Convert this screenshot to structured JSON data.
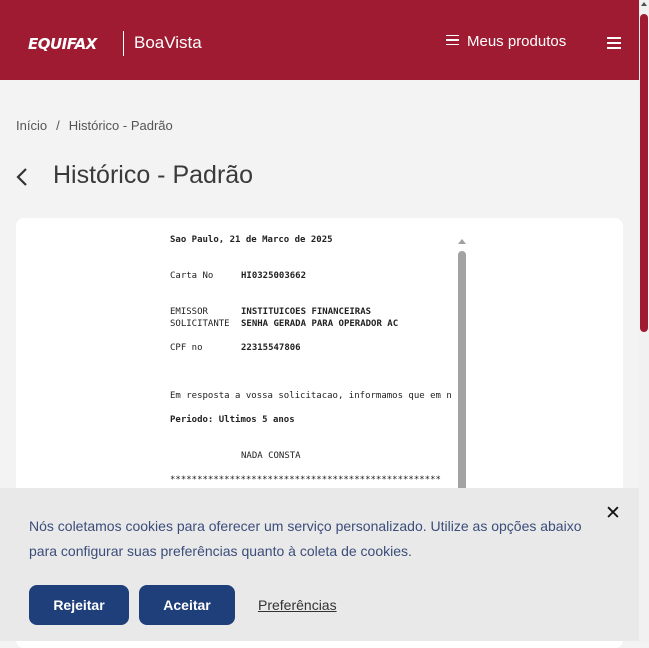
{
  "header": {
    "logo_left": "EQUIFAX",
    "logo_right": "BoaVista",
    "products_label": "Meus produtos"
  },
  "breadcrumb": {
    "home": "Início",
    "separator": "/",
    "current": "Histórico - Padrão"
  },
  "page_title": "Histórico - Padrão",
  "document": {
    "date_line": "Sao Paulo, 21 de Marco de 2025",
    "carta_label": "Carta No",
    "carta_value": "HI0325003662",
    "emissor_label": "EMISSOR",
    "emissor_value": "INSTITUICOES FINANCEIRAS",
    "solicitante_label": "SOLICITANTE",
    "solicitante_value": "SENHA GERADA PARA OPERADOR AC",
    "cpf_label": "CPF no",
    "cpf_value": "22315547806",
    "response_line": "Em resposta a vossa solicitacao, informamos que em n",
    "periodo_line": "Periodo: Ultimos 5 anos",
    "status": "NADA CONSTA",
    "divider": "**************************************************"
  },
  "cookie": {
    "text": "Nós coletamos cookies para oferecer um serviço personalizado. Utilize as opções abaixo para configurar suas preferências quanto à coleta de cookies.",
    "reject": "Rejeitar",
    "accept": "Aceitar",
    "preferences": "Preferências"
  },
  "colors": {
    "brand": "#9e1b32",
    "button": "#1f3f7a",
    "cookie_text": "#3b4d7a"
  }
}
